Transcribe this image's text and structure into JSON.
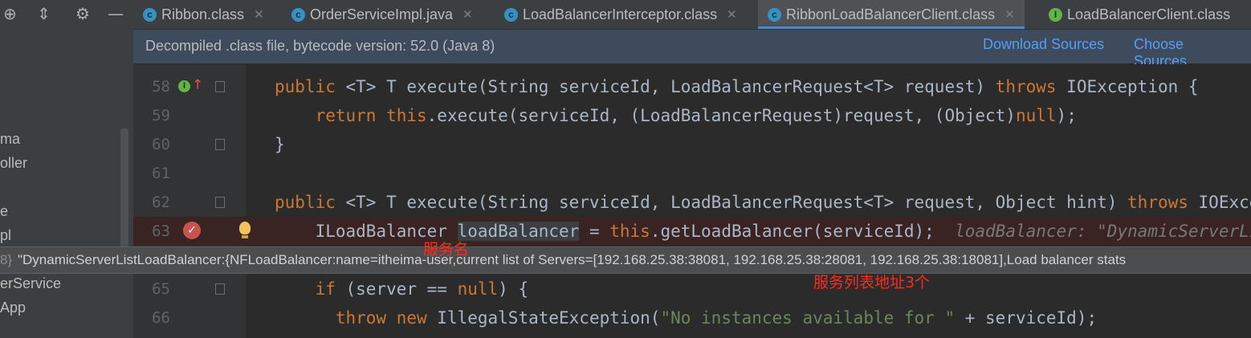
{
  "project_panel": {
    "items": [
      "ma",
      "oller",
      "e",
      "pl",
      "erService",
      "App"
    ]
  },
  "tabs": [
    {
      "label": "Ribbon.class",
      "icon": "class-icon",
      "active": false
    },
    {
      "label": "OrderServiceImpl.java",
      "icon": "class-icon",
      "active": false
    },
    {
      "label": "LoadBalancerInterceptor.class",
      "icon": "class-icon",
      "active": false
    },
    {
      "label": "RibbonLoadBalancerClient.class",
      "icon": "class-icon",
      "active": true
    },
    {
      "label": "LoadBalancerClient.class",
      "icon": "interface-icon",
      "active": false
    }
  ],
  "infobar": {
    "message": "Decompiled .class file, bytecode version: 52.0 (Java 8)",
    "download_sources": "Download Sources",
    "choose_sources": "Choose Sources..."
  },
  "editor": {
    "lines": [
      {
        "num": "58"
      },
      {
        "num": "59"
      },
      {
        "num": "60"
      },
      {
        "num": "61"
      },
      {
        "num": "62"
      },
      {
        "num": "63"
      },
      {
        "num": "65"
      },
      {
        "num": "66"
      }
    ],
    "inline_hint": "loadBalancer: \"DynamicServerListLoadBalancer",
    "exception_message": "\"No instances available for \""
  },
  "tooltip": {
    "prefix": "8}",
    "text": "\"DynamicServerListLoadBalancer:{NFLoadBalancer:name=itheima-user,current list of Servers=[192.168.25.38:38081, 192.168.25.38:28081, 192.168.25.38:18081],Load balancer stats"
  },
  "annotations": {
    "service_name": "服务名",
    "server_list": "服务列表地址3个"
  },
  "colors": {
    "keyword": "#cc7832",
    "string": "#6a8759",
    "link": "#589df6",
    "annotation": "#ff2b1a",
    "active_tab_underline": "#4a88c7"
  }
}
